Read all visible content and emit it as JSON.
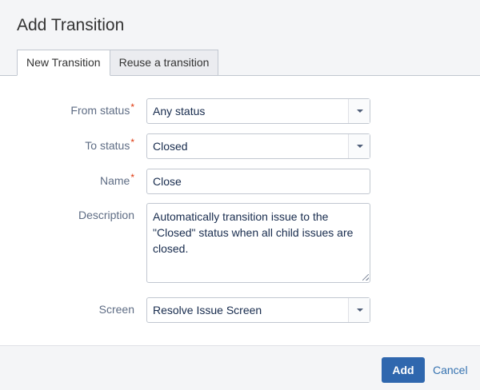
{
  "dialog": {
    "title": "Add Transition",
    "tabs": [
      {
        "label": "New Transition",
        "active": true
      },
      {
        "label": "Reuse a transition",
        "active": false
      }
    ]
  },
  "form": {
    "required_marker": "*",
    "from_status": {
      "label": "From status",
      "value": "Any status",
      "required": true
    },
    "to_status": {
      "label": "To status",
      "value": "Closed",
      "required": true
    },
    "name": {
      "label": "Name",
      "value": "Close",
      "required": true
    },
    "description": {
      "label": "Description",
      "value": "Automatically transition issue to the \"Closed\" status when all child issues are closed."
    },
    "screen": {
      "label": "Screen",
      "value": "Resolve Issue Screen"
    }
  },
  "footer": {
    "add_label": "Add",
    "cancel_label": "Cancel"
  },
  "colors": {
    "primary": "#2f67ae",
    "link": "#3572b0",
    "required": "#de350b"
  }
}
